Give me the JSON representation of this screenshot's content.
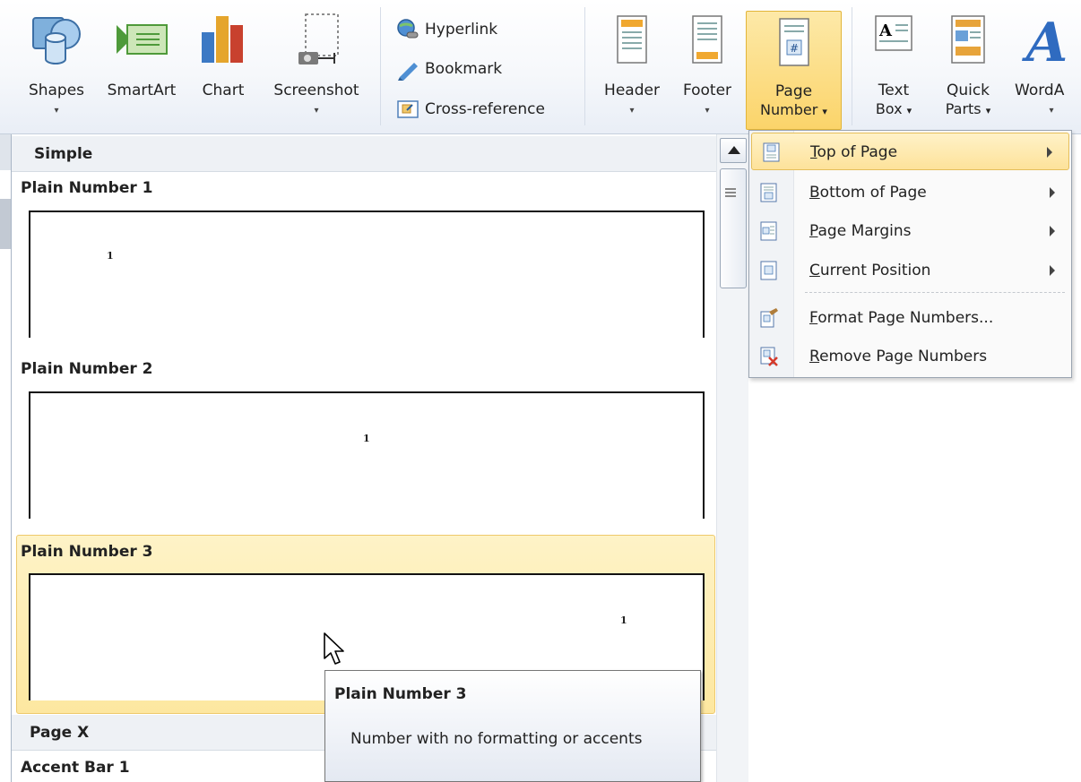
{
  "ribbon": {
    "shapes": "Shapes",
    "smartart": "SmartArt",
    "chart": "Chart",
    "screenshot": "Screenshot",
    "hyperlink": "Hyperlink",
    "bookmark": "Bookmark",
    "cross_reference": "Cross-reference",
    "header": "Header",
    "footer": "Footer",
    "page_number_line1": "Page",
    "page_number_line2": "Number",
    "text_box_line1": "Text",
    "text_box_line2": "Box",
    "quick_parts_line1": "Quick",
    "quick_parts_line2": "Parts",
    "wordart": "WordA",
    "dropdown_glyph": "▾"
  },
  "gallery": {
    "category_simple": "Simple",
    "category_page_x": "Page X",
    "items": [
      {
        "title": "Plain Number 1",
        "preview_number": "1"
      },
      {
        "title": "Plain Number 2",
        "preview_number": "1"
      },
      {
        "title": "Plain Number 3",
        "preview_number": "1",
        "highlighted": true
      },
      {
        "title": "Accent Bar 1"
      }
    ]
  },
  "submenu": {
    "items": [
      {
        "accel": "T",
        "rest": "op of Page",
        "has_submenu": true,
        "highlighted": true,
        "icon": "page-number-top-icon"
      },
      {
        "accel": "B",
        "rest": "ottom of Page",
        "has_submenu": true,
        "icon": "page-number-bottom-icon"
      },
      {
        "accel": "P",
        "rest": "age Margins",
        "has_submenu": true,
        "icon": "page-margins-icon"
      },
      {
        "accel": "C",
        "rest": "urrent Position",
        "has_submenu": true,
        "icon": "current-position-icon"
      },
      {
        "accel": "F",
        "rest": "ormat Page Numbers...",
        "has_submenu": false,
        "icon": "format-page-numbers-icon"
      },
      {
        "accel": "R",
        "rest": "emove Page Numbers",
        "has_submenu": false,
        "icon": "remove-page-numbers-icon"
      }
    ]
  },
  "tooltip": {
    "title": "Plain Number 3",
    "body": "Number with no formatting or accents"
  },
  "colors": {
    "highlight": "#fde7a0",
    "highlight_border": "#eec96b",
    "ribbon_bg": "#f6f8fb"
  }
}
